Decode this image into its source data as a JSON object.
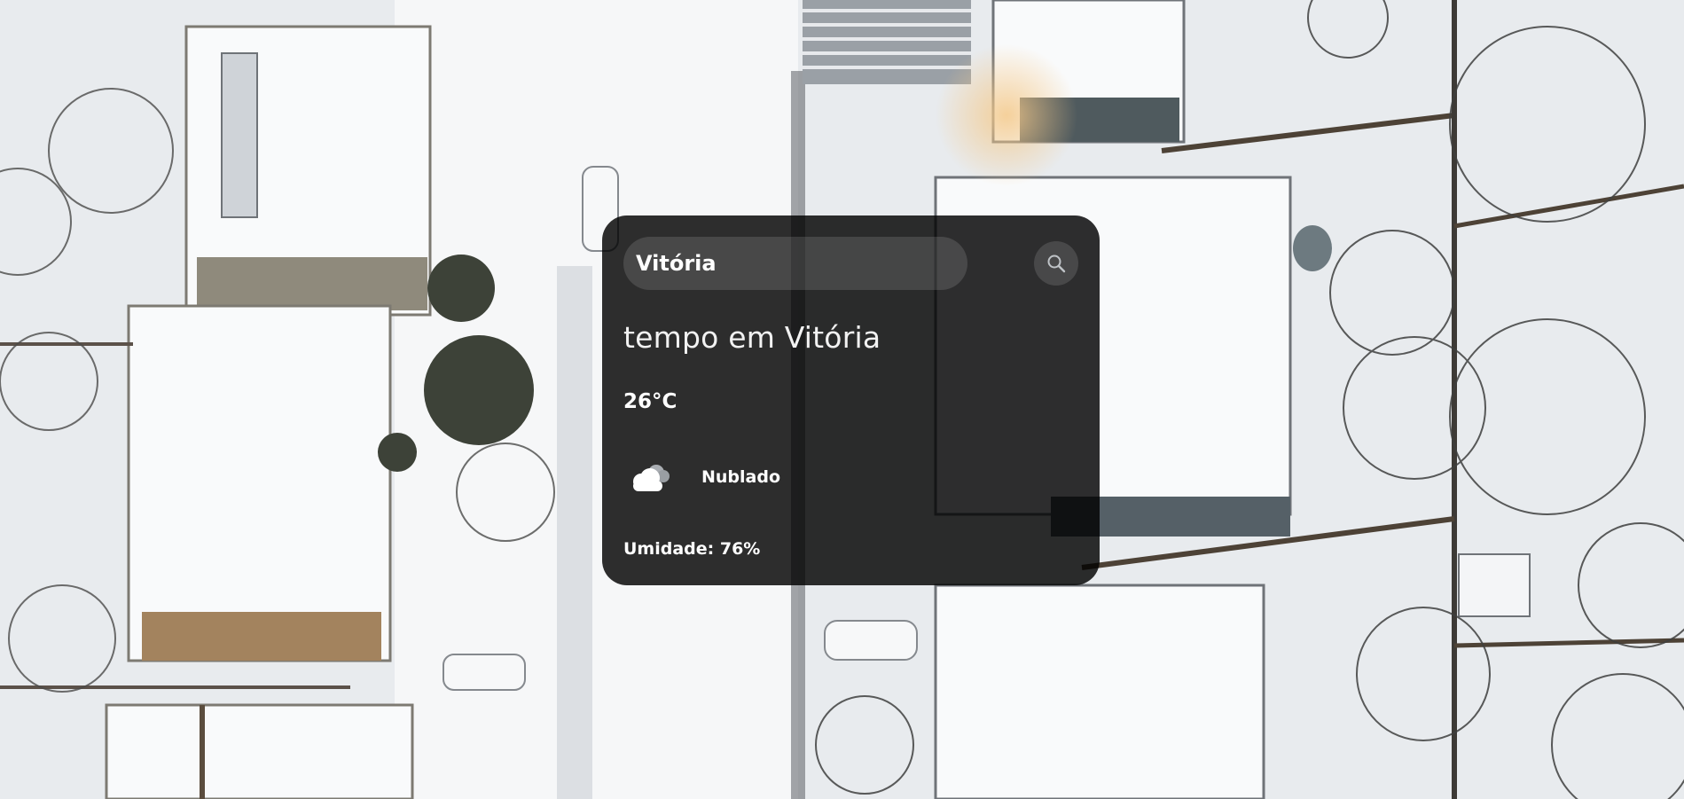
{
  "background": {
    "description_icon": "aerial-snow-neighborhood-photo"
  },
  "search": {
    "value": "Vitória",
    "button_icon": "search-icon"
  },
  "weather": {
    "title": "tempo em Vitória",
    "temperature": "26°C",
    "condition_icon": "cloud-icon",
    "condition": "Nublado",
    "humidity": "Umidade: 76%"
  },
  "colors": {
    "card_background": "#000000",
    "text": "#ffffff",
    "snow": "#eef1f4"
  }
}
